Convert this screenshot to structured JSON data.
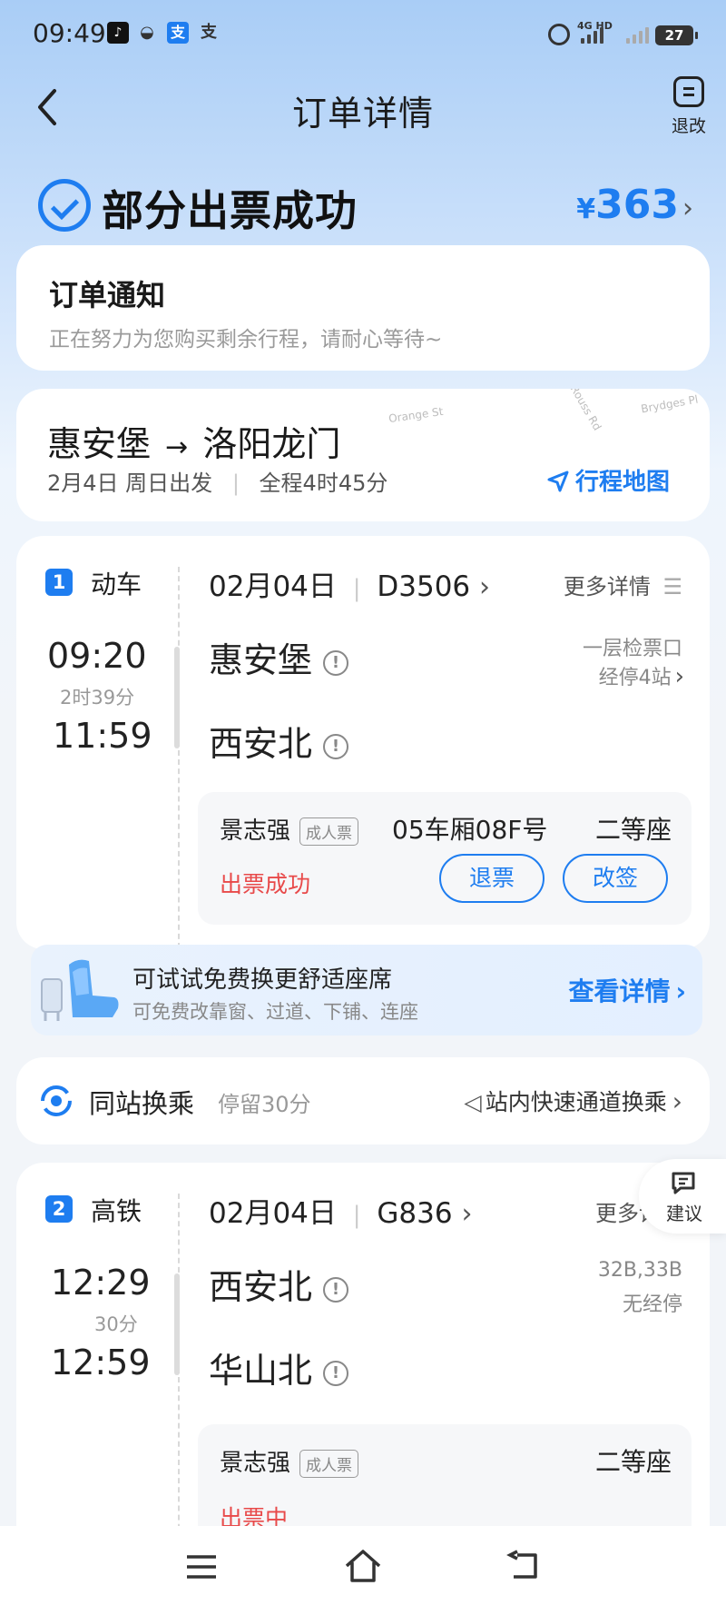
{
  "status_bar": {
    "time": "09:49",
    "net": "4G HD",
    "battery": "27"
  },
  "header": {
    "title": "订单详情",
    "refund_label": "退改"
  },
  "status": {
    "text": "部分出票成功",
    "currency": "¥",
    "amount": "363"
  },
  "notice": {
    "title": "订单通知",
    "text": "正在努力为您购买剩余行程，请耐心等待~"
  },
  "trip": {
    "from": "惠安堡",
    "arrow": "→",
    "to": "洛阳龙门",
    "date": "2月4日 周日出发",
    "duration": "全程4时45分",
    "map_label": "行程地图",
    "map_streets": [
      "Orange St",
      "Rouss Rd",
      "Brydges Pl"
    ]
  },
  "legs": [
    {
      "num": "1",
      "type": "动车",
      "date": "02月04日",
      "train": "D3506",
      "more": "更多详情",
      "dep_time": "09:20",
      "duration": "2时39分",
      "arr_time": "11:59",
      "from": "惠安堡",
      "to": "西安北",
      "gate": "一层检票口",
      "stops": "经停4站",
      "passenger": "景志强",
      "ticket_type": "成人票",
      "seat": "05车厢08F号",
      "cls": "二等座",
      "ticket_status": "出票成功",
      "refund_btn": "退票",
      "change_btn": "改签"
    },
    {
      "num": "2",
      "type": "高铁",
      "date": "02月04日",
      "train": "G836",
      "more": "更多详情",
      "dep_time": "12:29",
      "duration": "30分",
      "arr_time": "12:59",
      "from": "西安北",
      "to": "华山北",
      "gate": "32B,33B",
      "stops": "无经停",
      "passenger": "景志强",
      "ticket_type": "成人票",
      "seat": "",
      "cls": "二等座",
      "ticket_status": "出票中"
    }
  ],
  "upgrade": {
    "title": "可试试免费换更舒适座席",
    "sub": "可免费改靠窗、过道、下铺、连座",
    "link": "查看详情"
  },
  "transfer": {
    "title": "同站换乘",
    "stay": "停留30分",
    "fast": "站内快速通道换乘"
  },
  "suggest": {
    "label": "建议"
  },
  "colors": {
    "accent": "#1e7df0",
    "success": "#e84a4a",
    "bg_top": "#a9cdf6"
  }
}
